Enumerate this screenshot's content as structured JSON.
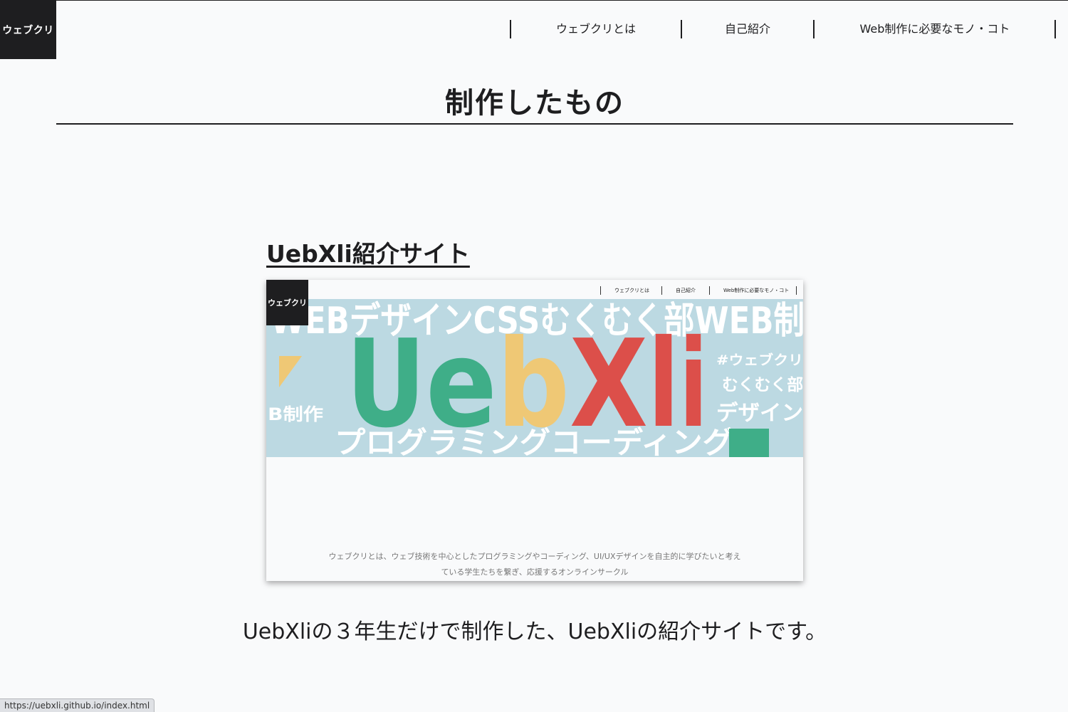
{
  "header": {
    "logo": "ウェブクリ",
    "nav": [
      "ウェブクリとは",
      "自己紹介",
      "Web制作に必要なモノ・コト"
    ]
  },
  "section": {
    "title": "制作したもの"
  },
  "work": {
    "title": "UebXli紹介サイト",
    "screenshot": {
      "logo": "ウェブクリ",
      "nav": [
        "ウェブクリとは",
        "自己紹介",
        "Web制作に必要なモノ・コト"
      ],
      "banner_word": "UebXli",
      "banner_letters": [
        {
          "text": "U",
          "color": "#3fae88"
        },
        {
          "text": "e",
          "color": "#3fae88"
        },
        {
          "text": "b",
          "color": "#efc875"
        },
        {
          "text": "X",
          "color": "#dc4f4a"
        },
        {
          "text": "l",
          "color": "#dc4f4a"
        },
        {
          "text": "i",
          "color": "#dc4f4a"
        }
      ],
      "banner_background": "#bcd9e2",
      "background_words": [
        "WEBデザインCSSむくむく部WEB制",
        "プログラミングコーディング",
        "#ウェブクリ",
        "むくむく部",
        "デザイン",
        "B制作"
      ],
      "description_line1": "ウェブクリとは、ウェブ技術を中心としたプログラミングやコーディング、UI/UXデザインを自主的に学びたいと考え",
      "description_line2": "ている学生たちを繋ぎ、応援するオンラインサークル"
    },
    "caption": "UebXliの３年生だけで制作した、UebXliの紹介サイトです。"
  },
  "status_bar": {
    "url": "https://uebxli.github.io/index.html"
  },
  "colors": {
    "background": "#f9fafb",
    "text": "#1e1e20",
    "green": "#3fae88",
    "yellow": "#efc875",
    "red": "#dc4f4a",
    "light_blue": "#bcd9e2"
  }
}
